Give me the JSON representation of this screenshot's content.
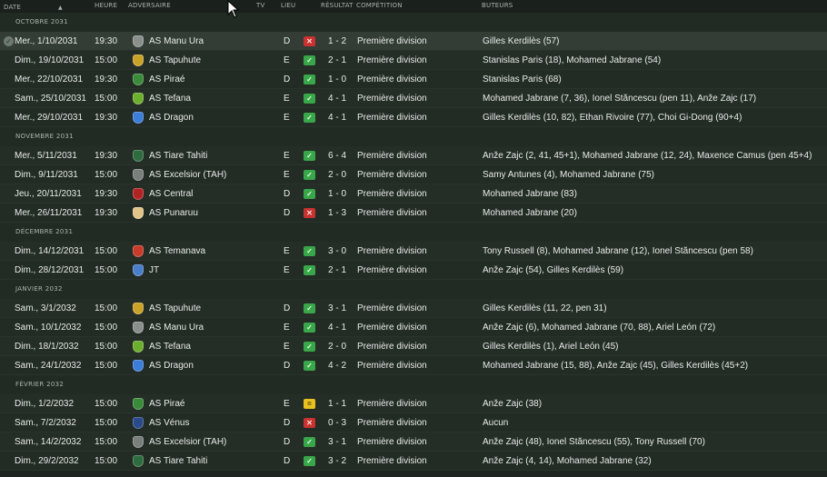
{
  "header": {
    "date": "DATE",
    "time": "HEURE",
    "opponent": "ADVERSAIRE",
    "tv": "TV",
    "venue": "LIEU",
    "result": "RÉSULTAT",
    "competition": "COMPÉTITION",
    "scorers": "BUTEURS",
    "sort_icon": "sort-up-arrow"
  },
  "months": [
    {
      "label": "OCTOBRE 2031",
      "matches": [
        {
          "date": "Mer., 1/10/2031",
          "time": "19:30",
          "opponent": "AS Manu Ura",
          "crest": "#8a8f8c",
          "venue": "D",
          "outcome": "loss",
          "score": "1 - 2",
          "competition": "Première division",
          "scorers": "Gilles Kerdilès (57)"
        },
        {
          "date": "Dim., 19/10/2031",
          "time": "15:00",
          "opponent": "AS Tapuhute",
          "crest": "#c9a227",
          "venue": "E",
          "outcome": "win",
          "score": "2 - 1",
          "competition": "Première division",
          "scorers": "Stanislas Paris (18), Mohamed Jabrane (54)"
        },
        {
          "date": "Mer., 22/10/2031",
          "time": "19:30",
          "opponent": "AS Piraé",
          "crest": "#3a8a3a",
          "venue": "D",
          "outcome": "win",
          "score": "1 - 0",
          "competition": "Première division",
          "scorers": "Stanislas Paris (68)"
        },
        {
          "date": "Sam., 25/10/2031",
          "time": "15:00",
          "opponent": "AS Tefana",
          "crest": "#6cae2e",
          "venue": "E",
          "outcome": "win",
          "score": "4 - 1",
          "competition": "Première division",
          "scorers": "Mohamed Jabrane (7, 36), Ionel Stăncescu (pen 11), Anže Zajc (17)"
        },
        {
          "date": "Mer., 29/10/2031",
          "time": "19:30",
          "opponent": "AS Dragon",
          "crest": "#3b7dd8",
          "venue": "E",
          "outcome": "win",
          "score": "4 - 1",
          "competition": "Première division",
          "scorers": "Gilles Kerdilès (10, 82), Ethan Rivoire (77), Choi Gi-Dong (90+4)"
        }
      ]
    },
    {
      "label": "NOVEMBRE 2031",
      "matches": [
        {
          "date": "Mer., 5/11/2031",
          "time": "19:30",
          "opponent": "AS Tiare Tahiti",
          "crest": "#2e6b3e",
          "venue": "E",
          "outcome": "win",
          "score": "6 - 4",
          "competition": "Première division",
          "scorers": "Anže Zajc (2, 41, 45+1), Mohamed Jabrane (12, 24), Maxence Camus (pen 45+4)"
        },
        {
          "date": "Dim., 9/11/2031",
          "time": "15:00",
          "opponent": "AS Excelsior (TAH)",
          "crest": "#7a7f7c",
          "venue": "E",
          "outcome": "win",
          "score": "2 - 0",
          "competition": "Première division",
          "scorers": "Samy Antunes (4), Mohamed Jabrane (75)"
        },
        {
          "date": "Jeu., 20/11/2031",
          "time": "19:30",
          "opponent": "AS Central",
          "crest": "#b22424",
          "venue": "D",
          "outcome": "win",
          "score": "1 - 0",
          "competition": "Première division",
          "scorers": "Mohamed Jabrane (83)"
        },
        {
          "date": "Mer., 26/11/2031",
          "time": "19:30",
          "opponent": "AS Punaruu",
          "crest": "#e0c48a",
          "venue": "D",
          "outcome": "loss",
          "score": "1 - 3",
          "competition": "Première division",
          "scorers": "Mohamed Jabrane (20)"
        }
      ]
    },
    {
      "label": "DÉCEMBRE 2031",
      "matches": [
        {
          "date": "Dim., 14/12/2031",
          "time": "15:00",
          "opponent": "AS Temanava",
          "crest": "#c83a2a",
          "venue": "E",
          "outcome": "win",
          "score": "3 - 0",
          "competition": "Première division",
          "scorers": "Tony Russell (8), Mohamed Jabrane (12), Ionel Stăncescu (pen 58)"
        },
        {
          "date": "Dim., 28/12/2031",
          "time": "15:00",
          "opponent": "JT",
          "crest": "#4a7ec8",
          "venue": "E",
          "outcome": "win",
          "score": "2 - 1",
          "competition": "Première division",
          "scorers": "Anže Zajc (54), Gilles Kerdilès (59)"
        }
      ]
    },
    {
      "label": "JANVIER 2032",
      "matches": [
        {
          "date": "Sam., 3/1/2032",
          "time": "15:00",
          "opponent": "AS Tapuhute",
          "crest": "#c9a227",
          "venue": "D",
          "outcome": "win",
          "score": "3 - 1",
          "competition": "Première division",
          "scorers": "Gilles Kerdilès (11, 22, pen 31)"
        },
        {
          "date": "Sam., 10/1/2032",
          "time": "15:00",
          "opponent": "AS Manu Ura",
          "crest": "#8a8f8c",
          "venue": "E",
          "outcome": "win",
          "score": "4 - 1",
          "competition": "Première division",
          "scorers": "Anže Zajc (6), Mohamed Jabrane (70, 88), Ariel León (72)"
        },
        {
          "date": "Dim., 18/1/2032",
          "time": "15:00",
          "opponent": "AS Tefana",
          "crest": "#6cae2e",
          "venue": "E",
          "outcome": "win",
          "score": "2 - 0",
          "competition": "Première division",
          "scorers": "Gilles Kerdilès (1), Ariel León (45)"
        },
        {
          "date": "Sam., 24/1/2032",
          "time": "15:00",
          "opponent": "AS Dragon",
          "crest": "#3b7dd8",
          "venue": "D",
          "outcome": "win",
          "score": "4 - 2",
          "competition": "Première division",
          "scorers": "Mohamed Jabrane (15, 88), Anže Zajc (45), Gilles Kerdilès (45+2)"
        }
      ]
    },
    {
      "label": "FÉVRIER 2032",
      "matches": [
        {
          "date": "Dim., 1/2/2032",
          "time": "15:00",
          "opponent": "AS Piraé",
          "crest": "#3a8a3a",
          "venue": "E",
          "outcome": "draw",
          "score": "1 - 1",
          "competition": "Première division",
          "scorers": "Anže Zajc (38)"
        },
        {
          "date": "Sam., 7/2/2032",
          "time": "15:00",
          "opponent": "AS Vénus",
          "crest": "#2a4a8a",
          "venue": "D",
          "outcome": "loss",
          "score": "0 - 3",
          "competition": "Première division",
          "scorers": "Aucun"
        },
        {
          "date": "Sam., 14/2/2032",
          "time": "15:00",
          "opponent": "AS Excelsior (TAH)",
          "crest": "#7a7f7c",
          "venue": "D",
          "outcome": "win",
          "score": "3 - 1",
          "competition": "Première division",
          "scorers": "Anže Zajc (48), Ionel Stăncescu (55), Tony Russell (70)"
        },
        {
          "date": "Dim., 29/2/2032",
          "time": "15:00",
          "opponent": "AS Tiare Tahiti",
          "crest": "#2e6b3e",
          "venue": "D",
          "outcome": "win",
          "score": "3 - 2",
          "competition": "Première division",
          "scorers": "Anže Zajc (4, 14), Mohamed Jabrane (32)"
        }
      ]
    }
  ],
  "result_icons": {
    "win": "check-icon",
    "loss": "cross-icon",
    "draw": "draw-icon"
  },
  "colors": {
    "background": "#1f2621",
    "win": "#3aa64a",
    "loss": "#c8322f",
    "draw": "#e8c020"
  }
}
